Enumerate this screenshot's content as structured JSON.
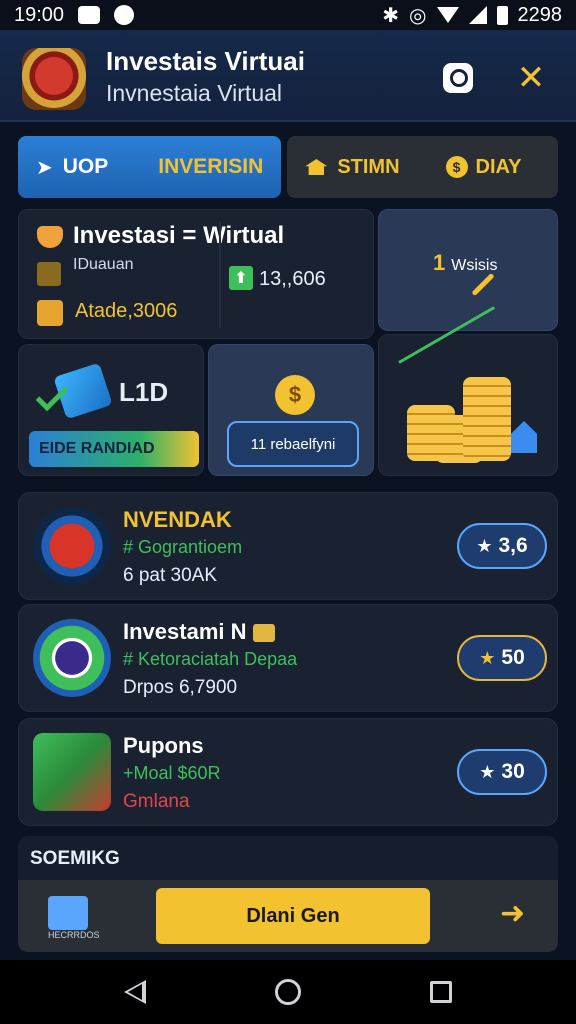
{
  "status_bar": {
    "time": "19:00",
    "right_text": "2298"
  },
  "header": {
    "title": "Investais Virtuai",
    "subtitle": "Invnestaia Virtual"
  },
  "tabs": [
    {
      "label1": "UOP",
      "label2": "INVERISIN"
    },
    {
      "label1": "STIMN",
      "label2": "DIAY"
    }
  ],
  "dashboard": {
    "main_title": "Investasi = Wirtual",
    "main_sub": "IDuauan",
    "main_value": "Atade,3006",
    "main_stat": "13,,606",
    "right_card_label": "Wsisis",
    "right_card_num": "1",
    "gift_code": "L1D",
    "gift_bar_label": "EIDE RANDIAD",
    "coin_button_label": "11 rebaelfyni"
  },
  "list": [
    {
      "name": "NVENDAK",
      "tag": "# Gograntioem",
      "meta": "6 pat 30AK",
      "pill_value": "3,6"
    },
    {
      "name": "Investami N",
      "tag": "# Ketoraciatah Depaa",
      "meta": "Drpos 6,7900",
      "pill_value": "50"
    },
    {
      "name": "Pupons",
      "tag": "+Moal $60R",
      "meta": "Gmlana",
      "pill_value": "30"
    }
  ],
  "section_label": "SOEMIKG",
  "action": {
    "bag_label": "HECRRDOS",
    "cta_label": "Dlani Gen"
  },
  "icons": {
    "close": "✕",
    "next": "➜",
    "star": "★",
    "dollar": "$",
    "coin": "$",
    "arrow": "➤",
    "home": "⌂"
  },
  "colors": {
    "accent": "#f2c230",
    "primary": "#2b7fd6",
    "background": "#0b1322",
    "positive": "#3fbf5a",
    "negative": "#e04848"
  }
}
